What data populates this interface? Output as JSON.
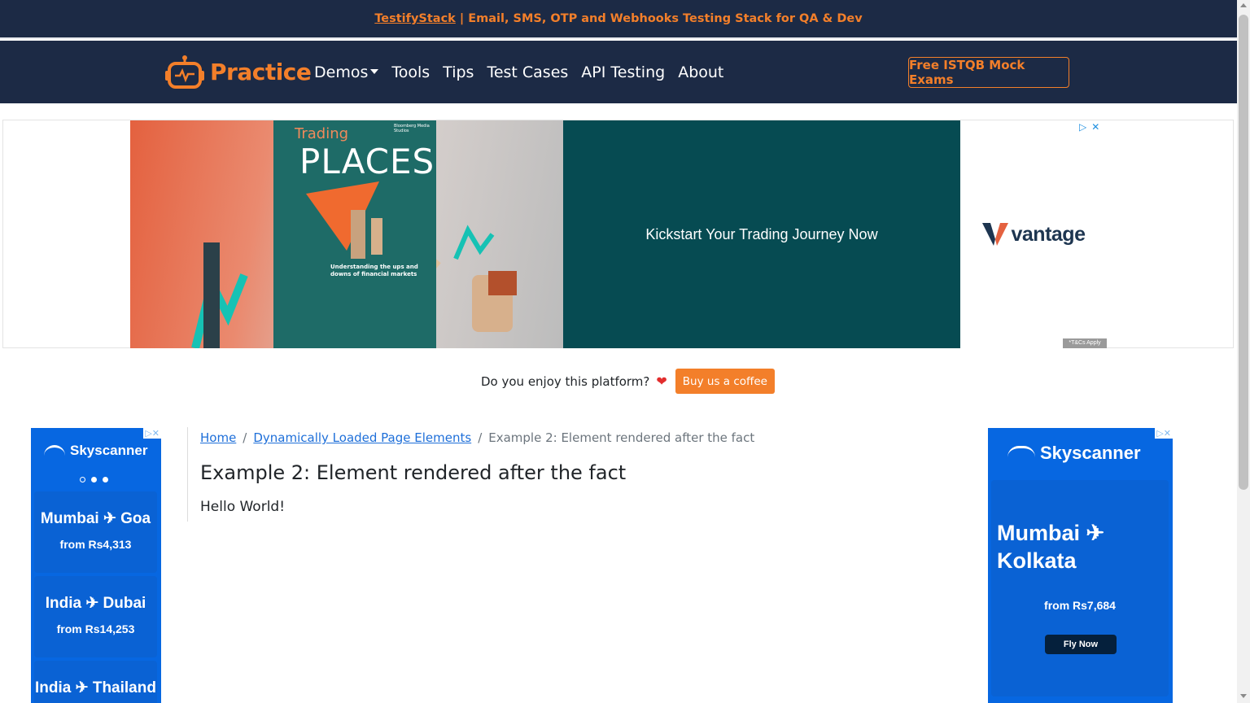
{
  "topbar": {
    "brand_link": "TestifyStack",
    "tagline": " | Email, SMS, OTP and Webhooks Testing Stack for QA & Dev"
  },
  "navbar": {
    "brand": "Practice",
    "logo_icon": "robot-icon",
    "items": [
      {
        "label": "Demos",
        "has_dropdown": true
      },
      {
        "label": "Tools"
      },
      {
        "label": "Tips"
      },
      {
        "label": "Test Cases"
      },
      {
        "label": "API Testing"
      },
      {
        "label": "About"
      }
    ],
    "cta_label": "Free ISTQB Mock Exams"
  },
  "top_ad": {
    "book_title_small": "Trading",
    "book_title_large": "PLACES",
    "book_publisher": "Bloomberg Media Studios",
    "book_subtitle": "Understanding the ups and downs of financial markets",
    "headline": "Kickstart Your Trading Journey Now",
    "brand": "vantage",
    "disclaimer": "*T&Cs Apply",
    "choices_icons": [
      "adchoices-icon",
      "close-icon"
    ]
  },
  "support": {
    "question": "Do you enjoy this platform?",
    "heart": "❤",
    "button_label": "Buy us a coffee"
  },
  "left_ad": {
    "brand": "Skyscanner",
    "deals": [
      {
        "route": "Mumbai ✈ Goa",
        "price": "from Rs4,313"
      },
      {
        "route": "India ✈ Dubai",
        "price": "from Rs14,253"
      },
      {
        "route": "India ✈ Thailand",
        "price": ""
      }
    ]
  },
  "right_ad": {
    "brand": "Skyscanner",
    "route_line1": "Mumbai ✈",
    "route_line2": "Kolkata",
    "price": "from Rs7,684",
    "button_label": "Fly Now"
  },
  "breadcrumb": {
    "home": "Home",
    "parent": "Dynamically Loaded Page Elements",
    "separator": "/",
    "current": "Example 2: Element rendered after the fact"
  },
  "main": {
    "title": "Example 2: Element rendered after the fact",
    "message": "Hello World!"
  },
  "colors": {
    "nav_bg": "#1c2a45",
    "accent": "#f37f2a",
    "link": "#1e6fd9",
    "skyscanner_blue": "#0767e1"
  }
}
